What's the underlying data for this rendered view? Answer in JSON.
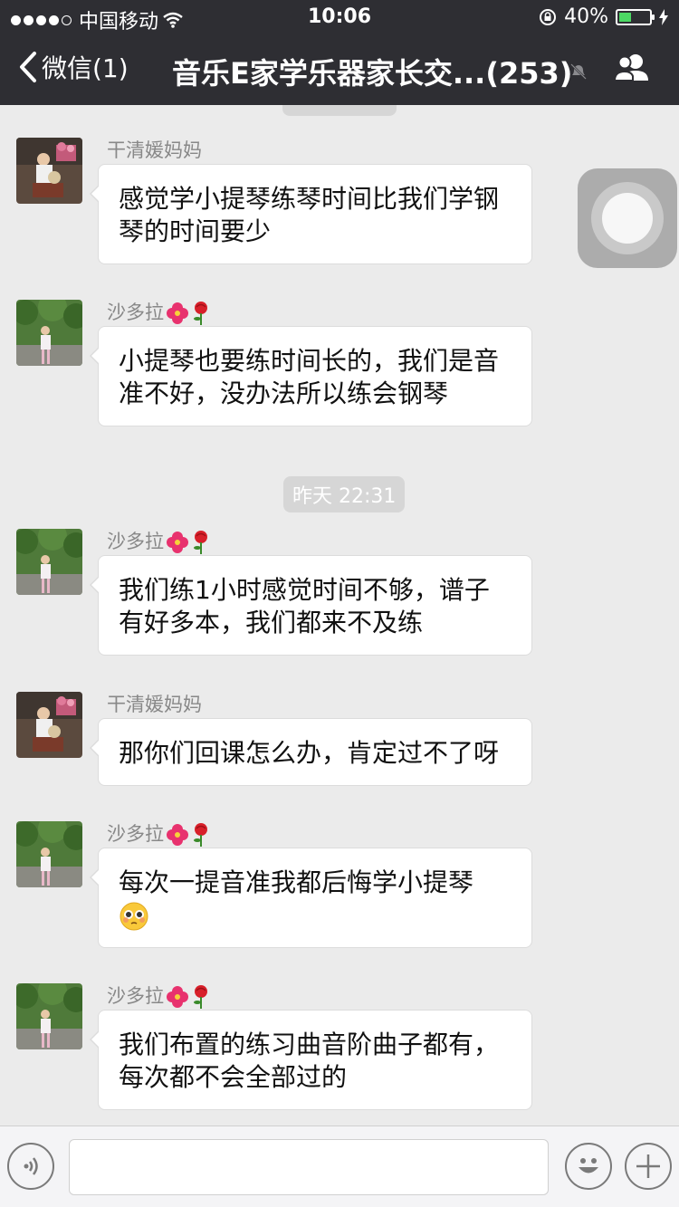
{
  "status_bar": {
    "carrier": "中国移动",
    "time": "10:06",
    "battery": "40%"
  },
  "nav": {
    "back_label": "微信(1)",
    "title": "音乐E家学乐器家长交...(253)"
  },
  "timestamps": [
    "昨天 22:31"
  ],
  "messages": [
    {
      "sender": "干清媛妈妈",
      "text": "感觉学小提琴练琴时间比我们学钢琴的时间要少"
    },
    {
      "sender": "沙多拉",
      "text": "小提琴也要练时间长的，我们是音准不好，没办法所以练会钢琴"
    },
    {
      "sender": "沙多拉",
      "text": "我们练1小时感觉时间不够，谱子有好多本，我们都来不及练"
    },
    {
      "sender": "干清媛妈妈",
      "text": "那你们回课怎么办，肯定过不了呀"
    },
    {
      "sender": "沙多拉",
      "text": "每次一提音准我都后悔学小提琴"
    },
    {
      "sender": "沙多拉",
      "text": "我们布置的练习曲音阶曲子都有，每次都不会全部过的"
    }
  ],
  "colors": {
    "nav_bg": "#2e2e33",
    "chat_bg": "#ebebeb",
    "bubble_bg": "#ffffff",
    "battery_fill": "#4cd964"
  }
}
